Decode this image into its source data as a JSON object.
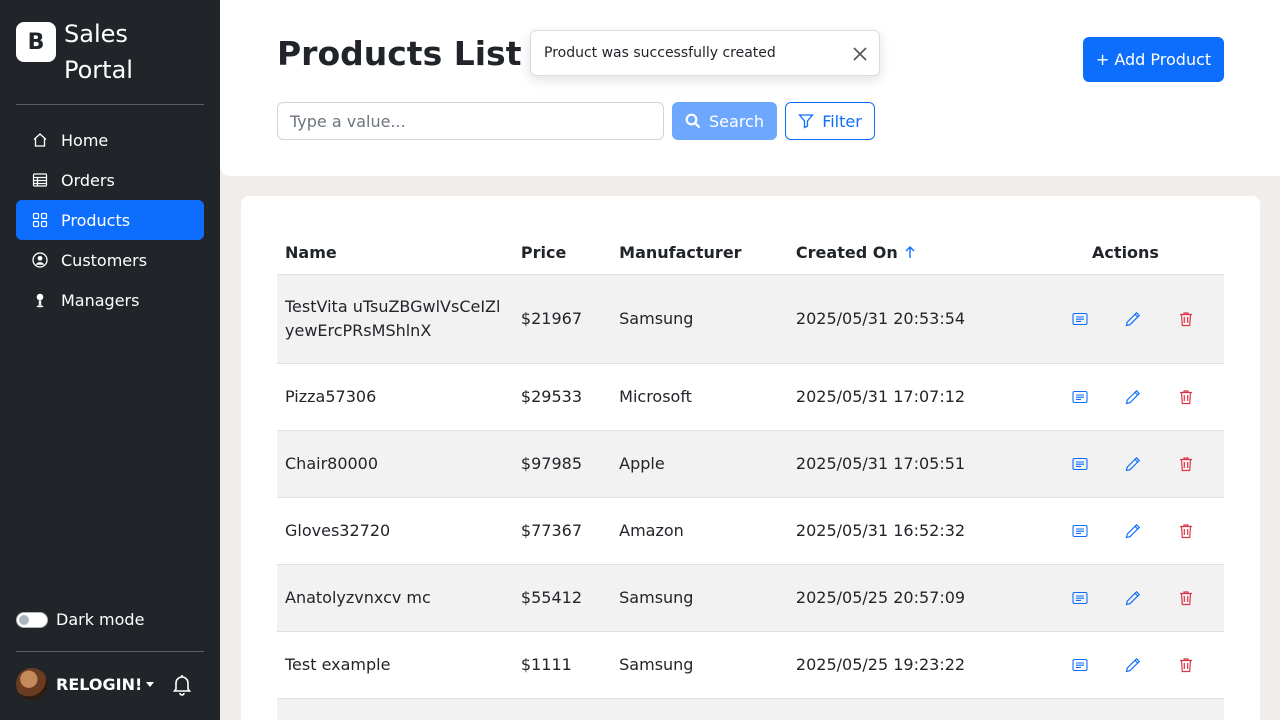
{
  "brand": {
    "logo_letter": "B",
    "line1": "Sales",
    "line2": "Portal"
  },
  "nav": {
    "items": [
      {
        "label": "Home",
        "icon": "home-icon"
      },
      {
        "label": "Orders",
        "icon": "table-icon"
      },
      {
        "label": "Products",
        "icon": "grid-icon",
        "active": true
      },
      {
        "label": "Customers",
        "icon": "person-circle-icon"
      },
      {
        "label": "Managers",
        "icon": "person-icon"
      }
    ]
  },
  "dark_mode": {
    "label": "Dark mode",
    "enabled": false
  },
  "user": {
    "name": "RELOGIN!"
  },
  "header": {
    "title": "Products List",
    "add_button": "+ Add Product",
    "search_placeholder": "Type a value...",
    "search_value": "",
    "search_button": "Search",
    "filter_button": "Filter"
  },
  "toast": {
    "message": "Product was successfully created"
  },
  "table": {
    "columns": {
      "name": "Name",
      "price": "Price",
      "manufacturer": "Manufacturer",
      "created": "Created On",
      "actions": "Actions"
    },
    "sort": {
      "column": "Created On",
      "direction": "ascending-arrow"
    },
    "rows": [
      {
        "name": "TestVita uTsuZBGwlVsCeIZlyewErcPRsMShlnX",
        "price": "$21967",
        "manufacturer": "Samsung",
        "created": "2025/05/31 20:53:54"
      },
      {
        "name": "Pizza57306",
        "price": "$29533",
        "manufacturer": "Microsoft",
        "created": "2025/05/31 17:07:12"
      },
      {
        "name": "Chair80000",
        "price": "$97985",
        "manufacturer": "Apple",
        "created": "2025/05/31 17:05:51"
      },
      {
        "name": "Gloves32720",
        "price": "$77367",
        "manufacturer": "Amazon",
        "created": "2025/05/31 16:52:32"
      },
      {
        "name": "Anatolyzvnxcv mc",
        "price": "$55412",
        "manufacturer": "Samsung",
        "created": "2025/05/25 20:57:09"
      },
      {
        "name": "Test example",
        "price": "$1111",
        "manufacturer": "Samsung",
        "created": "2025/05/25 19:23:22"
      }
    ]
  },
  "colors": {
    "primary": "#0d6efd",
    "danger": "#dc3545",
    "sidebar_bg": "#212529",
    "page_bg": "#f1edeb"
  }
}
